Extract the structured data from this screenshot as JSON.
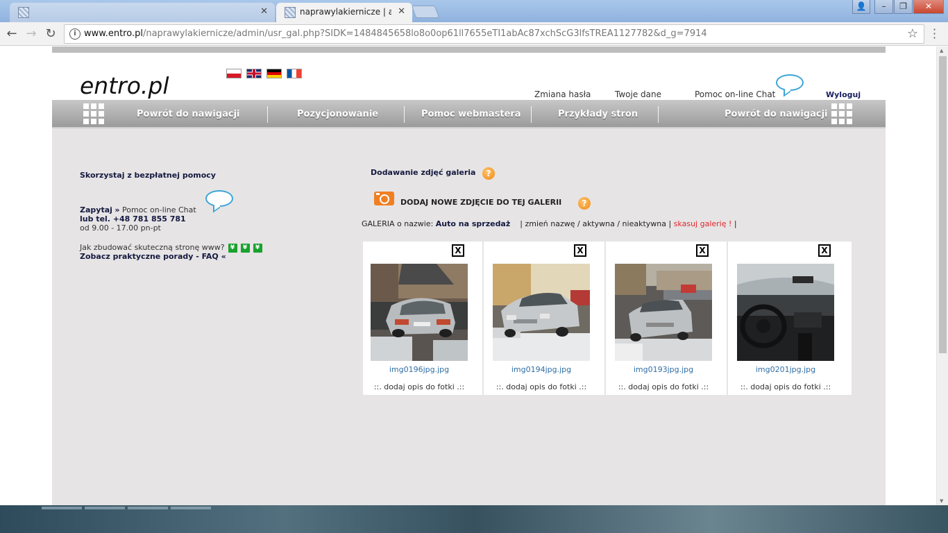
{
  "browser": {
    "tabs": [
      {
        "title": ""
      },
      {
        "title": "naprawylakiernicze | adm"
      }
    ],
    "address": {
      "host": "www.entro.pl",
      "path": "/naprawylakiernicze/admin/usr_gal.php?SIDK=1484845658lo8o0op61ll7655eTI1abAc87xchScG3lfsTREA1127782&d_g=7914"
    }
  },
  "header": {
    "logo": "entro.pl",
    "links": {
      "change_password": "Zmiana hasła",
      "your_data": "Twoje dane",
      "online_help": "Pomoc on-line Chat",
      "logout": "Wyloguj"
    }
  },
  "nav": {
    "items": [
      {
        "label": "Powrót do nawigacji"
      },
      {
        "label": "Pozycjonowanie"
      },
      {
        "label": "Pomoc webmastera"
      },
      {
        "label": "Przykłady stron"
      },
      {
        "label": "Powrót do nawigacji"
      }
    ]
  },
  "sidebar": {
    "title": "Skorzystaj z bezpłatnej pomocy",
    "ask": "Zapytaj",
    "ask_arrow": "»",
    "ask_chat": "Pomoc on-line Chat",
    "phone": "lub tel. +48 781 855 781",
    "hours": "od 9.00 - 17.00 pn-pt",
    "howto": "Jak zbudować skuteczną stronę www?",
    "faq": "Zobacz praktyczne porady - FAQ «"
  },
  "gallery": {
    "title": "Dodawanie zdjęć galeria",
    "add_photo": "DODAJ NOWE ZDJĘCIE DO TEJ GALERII",
    "name_prefix": "GALERIA o nazwie:",
    "name": "Auto na sprzedaż",
    "rename": "| zmień nazwę / aktywna / nieaktywna |",
    "delete": "skasuj galerię !",
    "end_sep": "|",
    "delete_photo_label": "X",
    "photos": [
      {
        "file": "img0196jpg.jpg",
        "desc": "::. dodaj opis do fotki .::"
      },
      {
        "file": "img0194jpg.jpg",
        "desc": "::. dodaj opis do fotki .::"
      },
      {
        "file": "img0193jpg.jpg",
        "desc": "::. dodaj opis do fotki .::"
      },
      {
        "file": "img0201jpg.jpg",
        "desc": "::. dodaj opis do fotki .::"
      }
    ]
  },
  "colors": {
    "accent_navy": "#14193f",
    "link_blue": "#2f6ea5",
    "danger_red": "#e0262a",
    "help_orange": "#f08a15"
  }
}
